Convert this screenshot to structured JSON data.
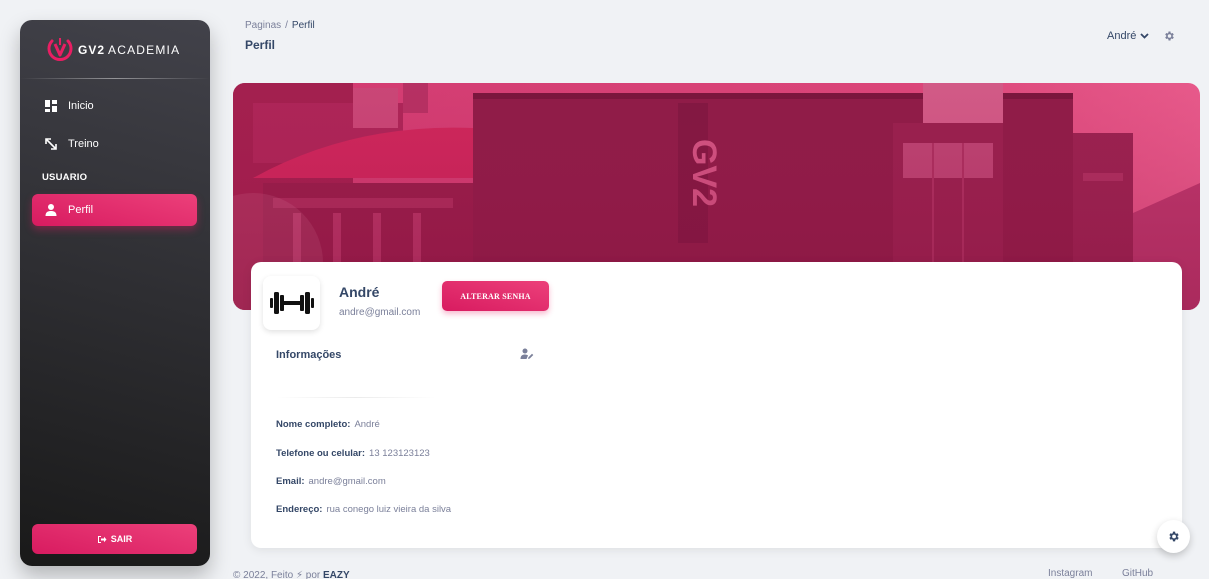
{
  "app": {
    "brand_bold": "GV2",
    "brand_rest": "ACADEMIA"
  },
  "sidebar": {
    "items": [
      {
        "label": "Inicio",
        "icon": "dashboard-icon"
      },
      {
        "label": "Treino",
        "icon": "arrows-diagonal-icon"
      }
    ],
    "section_label": "USUARIO",
    "active_item": {
      "label": "Perfil",
      "icon": "person-icon"
    },
    "logout_label": "SAIR"
  },
  "header": {
    "breadcrumb_root": "Paginas",
    "breadcrumb_sep": "/",
    "breadcrumb_current": "Perfil",
    "title": "Perfil",
    "user_name": "André"
  },
  "profile": {
    "name": "André",
    "email": "andre@gmail.com",
    "change_password_label": "ALTERAR SENHA",
    "info_title": "Informações",
    "fields": [
      {
        "label": "Nome completo:",
        "value": "André"
      },
      {
        "label": "Telefone ou celular:",
        "value": "13 123123123"
      },
      {
        "label": "Email:",
        "value": "andre@gmail.com"
      },
      {
        "label": "Endereço:",
        "value": "rua conego luiz vieira da silva"
      }
    ]
  },
  "footer": {
    "copyright": "© 2022, Feito",
    "by_label": "por",
    "author": "EAZY",
    "links": [
      "Instagram",
      "GitHub"
    ]
  },
  "colors": {
    "accent": "#e91e63",
    "sidebar_dark": "#191919",
    "text_primary": "#344767",
    "text_muted": "#7b809a"
  }
}
